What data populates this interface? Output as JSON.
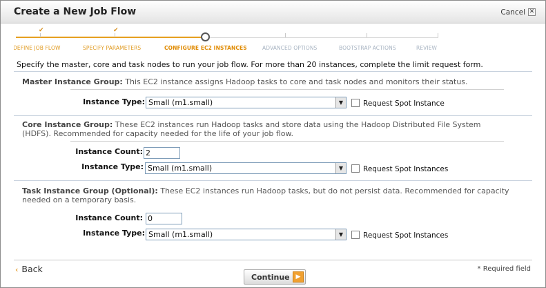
{
  "dialog": {
    "title": "Create a New Job Flow",
    "cancel_label": "Cancel",
    "close_glyph": "✕"
  },
  "steps": [
    {
      "label": "DEFINE JOB FLOW",
      "state": "done"
    },
    {
      "label": "SPECIFY PARAMETERS",
      "state": "done"
    },
    {
      "label": "CONFIGURE EC2 INSTANCES",
      "state": "current"
    },
    {
      "label": "ADVANCED OPTIONS",
      "state": "future"
    },
    {
      "label": "BOOTSTRAP ACTIONS",
      "state": "future"
    },
    {
      "label": "REVIEW",
      "state": "future"
    }
  ],
  "intro": "Specify the master, core and task nodes to run your job flow. For more than 20 instances, complete the limit request form.",
  "master": {
    "heading": "Master Instance Group:",
    "description": " This EC2 instance assigns Hadoop tasks to core and task nodes and monitors their status.",
    "instance_type_label": "Instance Type:",
    "instance_type_value": "Small (m1.small)",
    "spot_label": "Request Spot Instance"
  },
  "core": {
    "heading": "Core Instance Group:",
    "description_line1": " These EC2 instances run Hadoop tasks and store data using the Hadoop Distributed File System",
    "description_line2": "(HDFS). Recommended for capacity needed for the life of your job flow.",
    "instance_count_label": "Instance Count:",
    "instance_count_value": "2",
    "instance_type_label": "Instance Type:",
    "instance_type_value": "Small (m1.small)",
    "spot_label": "Request Spot Instances"
  },
  "task": {
    "heading": "Task Instance Group (Optional):",
    "description_line1": " These EC2 instances run Hadoop tasks, but do not persist data. Recommended for capacity",
    "description_line2": "needed on a temporary basis.",
    "instance_count_label": "Instance Count:",
    "instance_count_value": "0",
    "instance_type_label": "Instance Type:",
    "instance_type_value": "Small (m1.small)",
    "spot_label": "Request Spot Instances"
  },
  "footer": {
    "back_label": "Back",
    "continue_label": "Continue",
    "required_note": "* Required field"
  },
  "colors": {
    "accent": "#e08a00",
    "future_step": "#a8b4c2"
  }
}
